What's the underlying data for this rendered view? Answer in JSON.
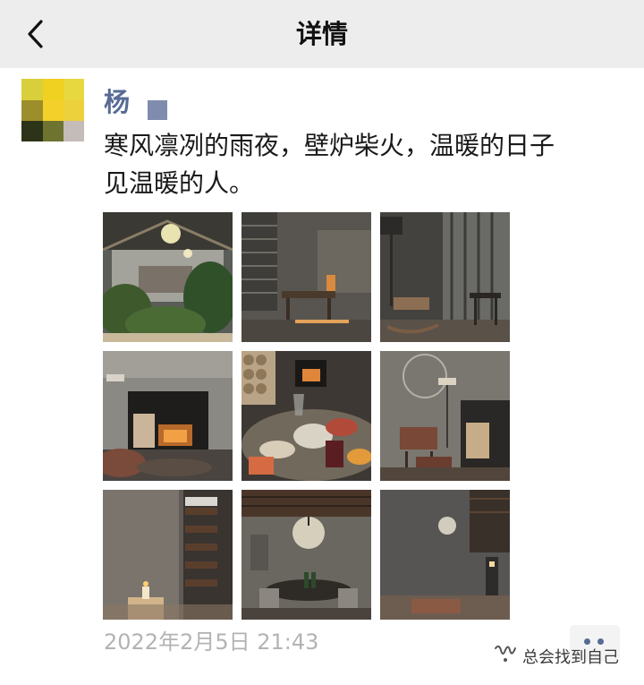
{
  "header": {
    "title": "详情",
    "back_icon": "chevron-left-icon"
  },
  "post": {
    "author": "杨",
    "text_line1": "寒风凛冽的雨夜，壁炉柴火，温暖的日子",
    "text_line2": "见温暖的人。",
    "timestamp": "2022年2月5日 21:43",
    "photo_count": 9
  },
  "watermark": {
    "text": "总会找到自己",
    "icon": "wechat-channel-icon"
  },
  "colors": {
    "topbar": "#ededed",
    "username": "#576b95",
    "timestamp": "#b3b3b3",
    "text": "#1a1a1a"
  }
}
